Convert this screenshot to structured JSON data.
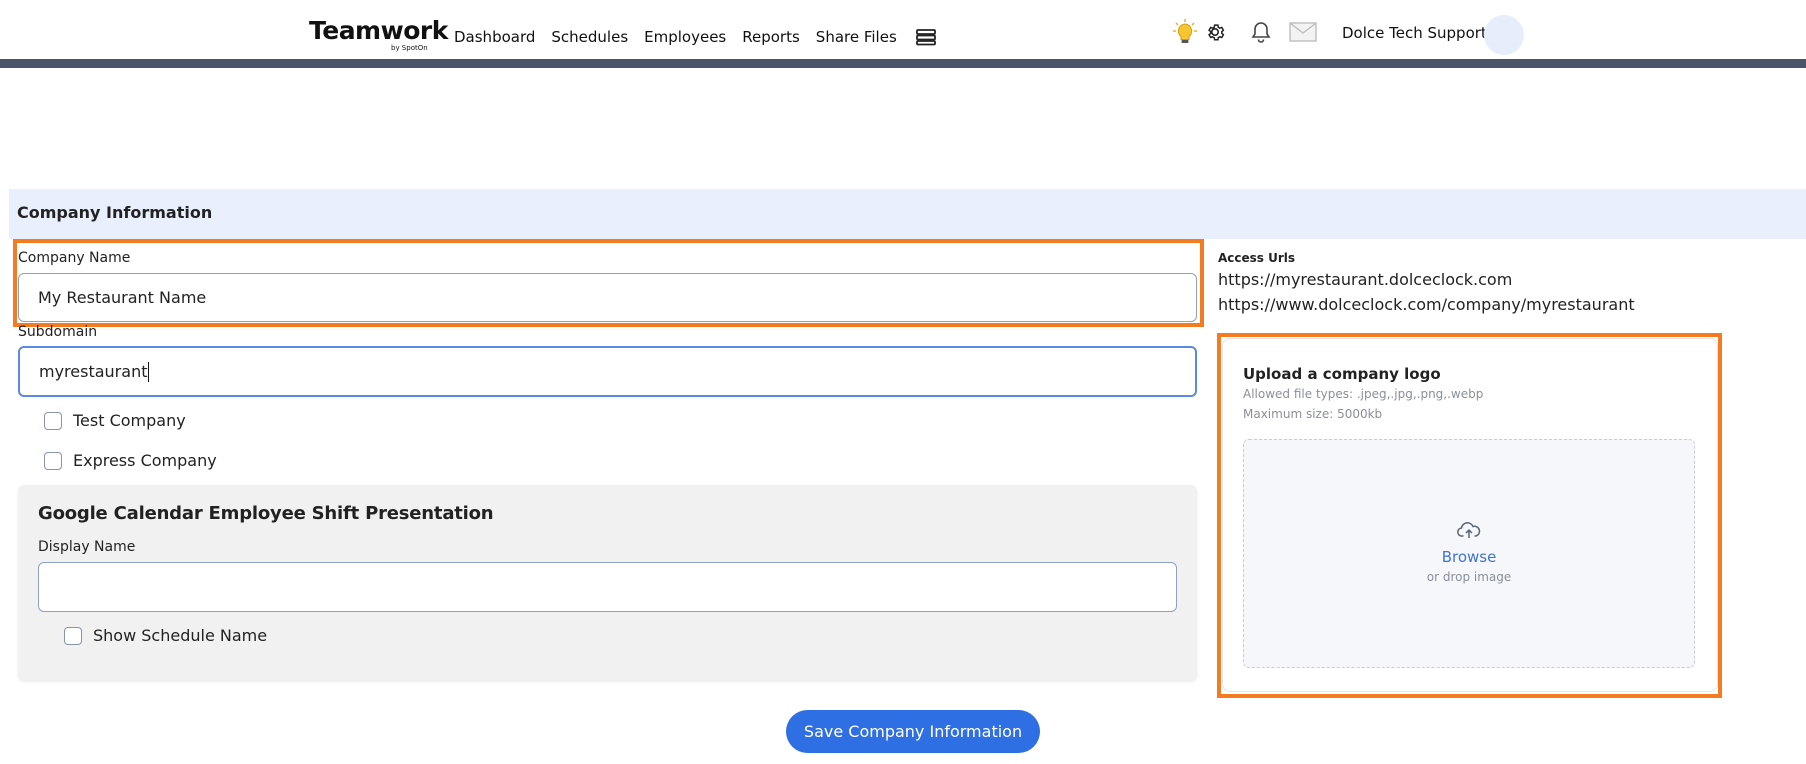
{
  "brand": {
    "name": "Teamwork",
    "byline": "by SpotOn"
  },
  "nav": {
    "items": [
      {
        "label": "Dashboard"
      },
      {
        "label": "Schedules"
      },
      {
        "label": "Employees"
      },
      {
        "label": "Reports"
      },
      {
        "label": "Share Files"
      }
    ]
  },
  "header": {
    "user_name": "Dolce Tech Support"
  },
  "section": {
    "title": "Company Information"
  },
  "form": {
    "company_name_label": "Company Name",
    "company_name_value": "My Restaurant Name",
    "subdomain_label": "Subdomain",
    "subdomain_value": "myrestaurant",
    "test_company_label": "Test Company",
    "express_company_label": "Express Company"
  },
  "google_calendar": {
    "title": "Google Calendar Employee Shift Presentation",
    "display_name_label": "Display Name",
    "display_name_value": "",
    "show_schedule_label": "Show Schedule Name"
  },
  "access": {
    "label": "Access Urls",
    "urls": [
      "https://myrestaurant.dolceclock.com",
      "https://www.dolceclock.com/company/myrestaurant"
    ]
  },
  "upload": {
    "title": "Upload a company logo",
    "allowed_types": "Allowed file types: .jpeg,.jpg,.png,.webp",
    "max_size": "Maximum size: 5000kb",
    "browse_label": "Browse",
    "drop_hint": "or drop image"
  },
  "actions": {
    "save_label": "Save Company Information"
  },
  "colors": {
    "accent": "#2f6fe4",
    "highlight": "#f47b20",
    "header_band": "#e9effc"
  }
}
